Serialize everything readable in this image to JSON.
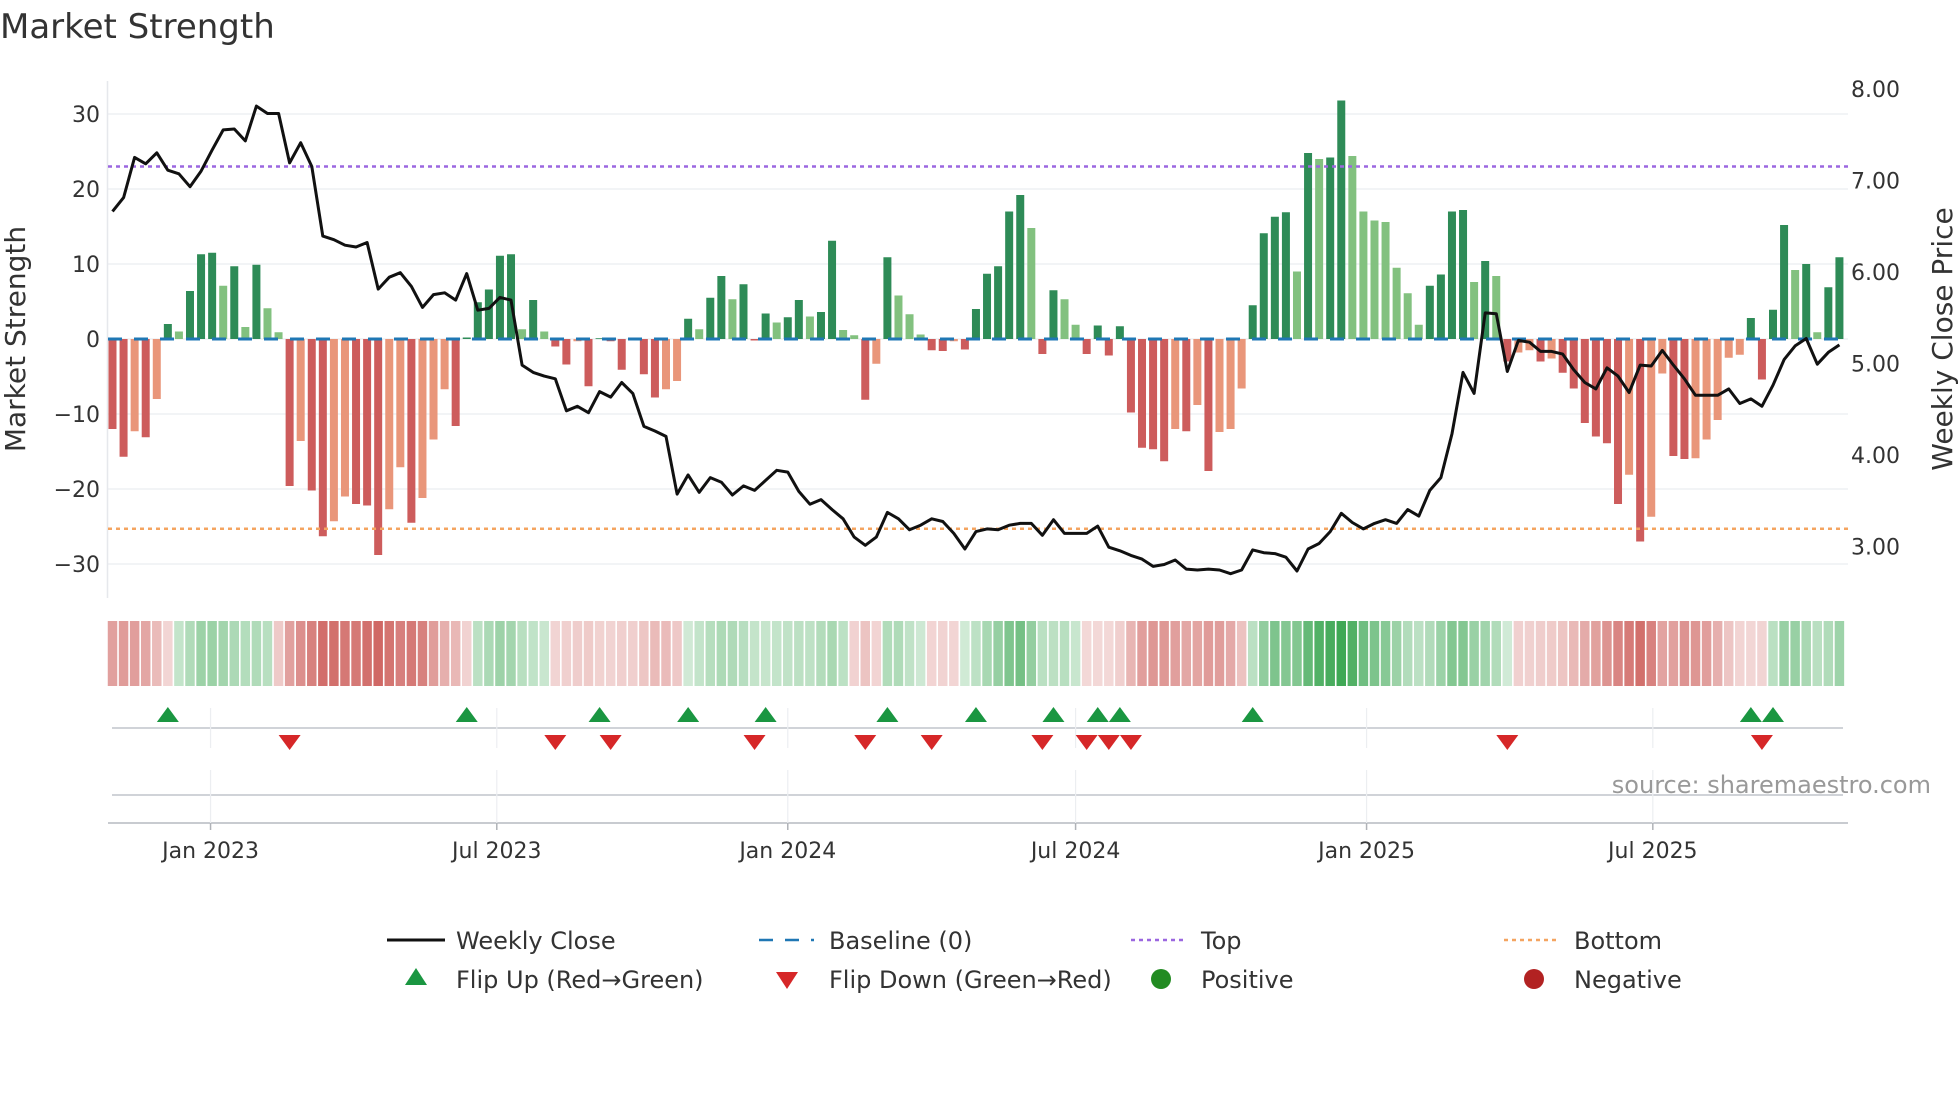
{
  "chart_data": {
    "type": "bar",
    "title": "Market Strength",
    "ylabel": "Market Strength",
    "y2label": "Weekly Close Price",
    "ylim": [
      -36,
      34
    ],
    "y2lim": [
      2.47,
      8.25
    ],
    "yticks": [
      "30",
      "20",
      "10",
      "0",
      "−10",
      "−20",
      "−30"
    ],
    "ytick_values": [
      30,
      20,
      10,
      0,
      -10,
      -20,
      -30
    ],
    "y2ticks": [
      "8.00",
      "7.00",
      "6.00",
      "5.00",
      "4.00",
      "3.00"
    ],
    "y2tick_values": [
      8,
      7,
      6,
      5,
      4,
      3
    ],
    "start_date": "2022-10-31",
    "step_days": 7,
    "xticks": [
      {
        "label": "Jan 2023",
        "date": "2023-01-01"
      },
      {
        "label": "Jul 2023",
        "date": "2023-07-01"
      },
      {
        "label": "Jan 2024",
        "date": "2024-01-01"
      },
      {
        "label": "Jul 2024",
        "date": "2024-07-01"
      },
      {
        "label": "Jan 2025",
        "date": "2025-01-01"
      },
      {
        "label": "Jul 2025",
        "date": "2025-07-01"
      }
    ],
    "top_level": 23,
    "bottom_level": -25.3,
    "baseline": 0,
    "grid": true,
    "legend_placement": "bottom",
    "strength": [
      -12,
      -15.7,
      -12.3,
      -13.1,
      -8,
      2,
      1,
      6.4,
      11.3,
      11.5,
      7.1,
      9.7,
      1.6,
      9.9,
      4.1,
      0.9,
      -19.6,
      -13.6,
      -20.2,
      -26.3,
      -24.3,
      -21,
      -22,
      -22.2,
      -28.8,
      -22.7,
      -17.1,
      -24.5,
      -21.2,
      -13.4,
      -6.7,
      -11.6,
      0.2,
      4.9,
      6.6,
      11.1,
      11.3,
      1.3,
      5.2,
      1,
      -1,
      -3.4,
      -0.3,
      -6.3,
      0.1,
      -0.3,
      -4.1,
      -0.1,
      -4.7,
      -7.8,
      -6.7,
      -5.6,
      2.7,
      1.3,
      5.5,
      8.4,
      5.3,
      7.3,
      -0.2,
      3.4,
      2.2,
      2.9,
      5.2,
      3.0,
      3.6,
      13.1,
      1.2,
      0.5,
      -8.1,
      -3.3,
      10.9,
      5.8,
      3.3,
      0.6,
      -1.5,
      -1.6,
      -0.3,
      -1.4,
      4,
      8.7,
      9.7,
      17,
      19.2,
      14.8,
      -2,
      6.5,
      5.3,
      1.9,
      -2,
      1.8,
      -2.2,
      1.7,
      -9.8,
      -14.5,
      -14.7,
      -16.3,
      -12,
      -12.3,
      -8.8,
      -17.6,
      -12.4,
      -12,
      -6.6,
      4.5,
      14.1,
      16.3,
      16.9,
      9,
      24.8,
      24,
      24.2,
      31.8,
      24.4,
      17,
      15.8,
      15.6,
      9.5,
      6.1,
      1.9,
      7.1,
      8.6,
      17,
      17.2,
      7.6,
      10.4,
      8.4,
      -3,
      -1.8,
      -1.5,
      -3,
      -2.6,
      -4.5,
      -6.6,
      -11.2,
      -13,
      -13.9,
      -22,
      -18.1,
      -27,
      -23.7,
      -4.6,
      -15.6,
      -16,
      -15.9,
      -13.4,
      -10.8,
      -2.5,
      -2.1,
      2.8,
      -5.4,
      3.9,
      15.2,
      9.2,
      10,
      0.9,
      6.9,
      10.9
    ],
    "weekly_close": [
      6.66,
      6.81,
      7.25,
      7.18,
      7.3,
      7.11,
      7.07,
      6.93,
      7.1,
      7.33,
      7.55,
      7.56,
      7.43,
      7.81,
      7.73,
      7.73,
      7.19,
      7.41,
      7.15,
      6.39,
      6.35,
      6.29,
      6.27,
      6.32,
      5.81,
      5.94,
      5.99,
      5.84,
      5.61,
      5.75,
      5.77,
      5.69,
      5.98,
      5.58,
      5.6,
      5.72,
      5.69,
      4.98,
      4.9,
      4.86,
      4.83,
      4.48,
      4.53,
      4.46,
      4.69,
      4.63,
      4.79,
      4.67,
      4.31,
      4.26,
      4.2,
      3.57,
      3.78,
      3.59,
      3.75,
      3.7,
      3.56,
      3.66,
      3.61,
      3.72,
      3.83,
      3.81,
      3.6,
      3.46,
      3.51,
      3.4,
      3.3,
      3.1,
      3.01,
      3.1,
      3.37,
      3.3,
      3.18,
      3.23,
      3.3,
      3.27,
      3.14,
      2.97,
      3.16,
      3.19,
      3.18,
      3.23,
      3.25,
      3.25,
      3.12,
      3.29,
      3.14,
      3.14,
      3.14,
      3.22,
      2.99,
      2.95,
      2.9,
      2.86,
      2.78,
      2.8,
      2.85,
      2.75,
      2.74,
      2.75,
      2.74,
      2.7,
      2.74,
      2.96,
      2.93,
      2.92,
      2.88,
      2.73,
      2.97,
      3.03,
      3.16,
      3.36,
      3.26,
      3.19,
      3.25,
      3.29,
      3.25,
      3.4,
      3.33,
      3.61,
      3.75,
      4.23,
      4.9,
      4.67,
      5.55,
      5.54,
      4.91,
      5.25,
      5.23,
      5.13,
      5.13,
      5.1,
      4.93,
      4.79,
      4.72,
      4.95,
      4.86,
      4.68,
      4.98,
      4.97,
      5.14,
      4.98,
      4.83,
      4.65,
      4.65,
      4.65,
      4.72,
      4.56,
      4.61,
      4.53,
      4.76,
      5.04,
      5.19,
      5.27,
      4.99,
      5.12,
      5.2
    ],
    "legend": {
      "weekly_close": "Weekly Close",
      "baseline": "Baseline (0)",
      "top": "Top",
      "bottom": "Bottom",
      "flip_up": "Flip Up (Red→Green)",
      "flip_down": "Flip Down (Green→Red)",
      "positive": "Positive",
      "negative": "Negative"
    },
    "source": "source: sharemaestro.com"
  },
  "colors": {
    "pos_dark": "#2e8b57",
    "pos_light": "#82c17f",
    "neg_dark": "#cd5c5c",
    "neg_light": "#e9967a",
    "baseline": "#1f77b4",
    "top": "#9b67e0",
    "bottom": "#f4a460",
    "price": "#111111",
    "flip_up": "#1a9641",
    "flip_down": "#d62728",
    "positive": "#228b22",
    "negative": "#b22222"
  }
}
